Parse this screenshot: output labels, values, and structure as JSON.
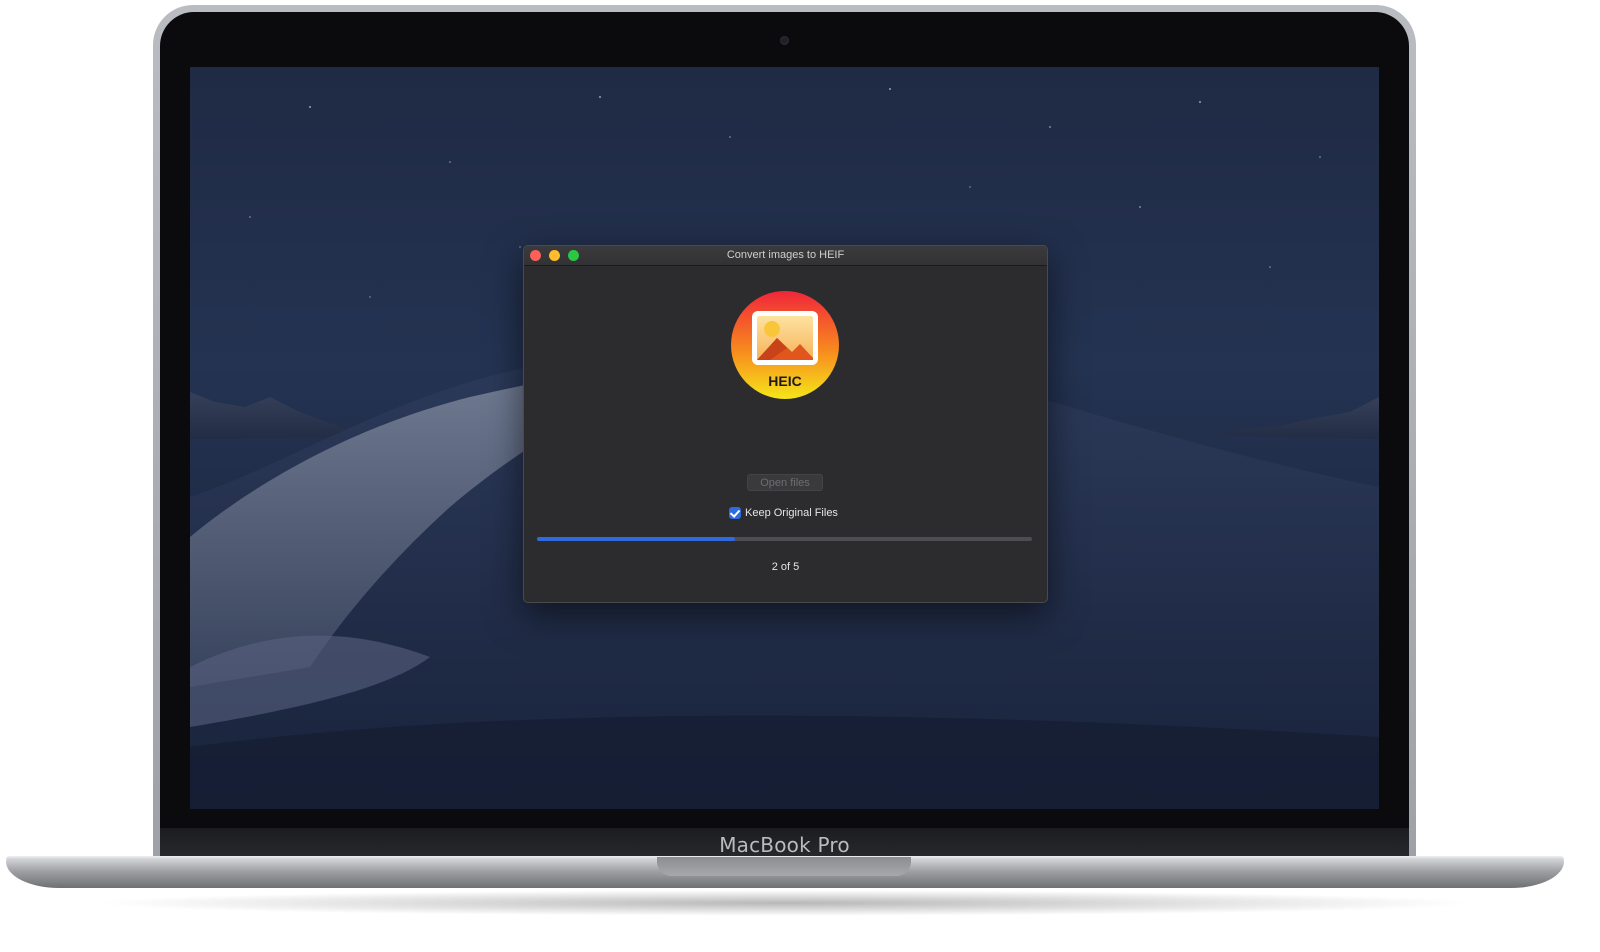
{
  "device": {
    "brand_label": "MacBook Pro"
  },
  "window": {
    "title": "Convert images to HEIF",
    "icon_label": "HEIC",
    "open_button_label": "Open files",
    "keep_original_label": "Keep Original Files",
    "keep_original_checked": true,
    "progress_fraction": 0.4,
    "status_text": "2 of 5"
  },
  "colors": {
    "accent": "#2e6ae0",
    "close": "#fe5f57",
    "minimize": "#febc2e",
    "maximize": "#28c840"
  },
  "icons": [
    "window-close-icon",
    "window-minimize-icon",
    "window-maximize-icon",
    "heic-app-icon",
    "checkmark-icon",
    "camera-icon"
  ]
}
